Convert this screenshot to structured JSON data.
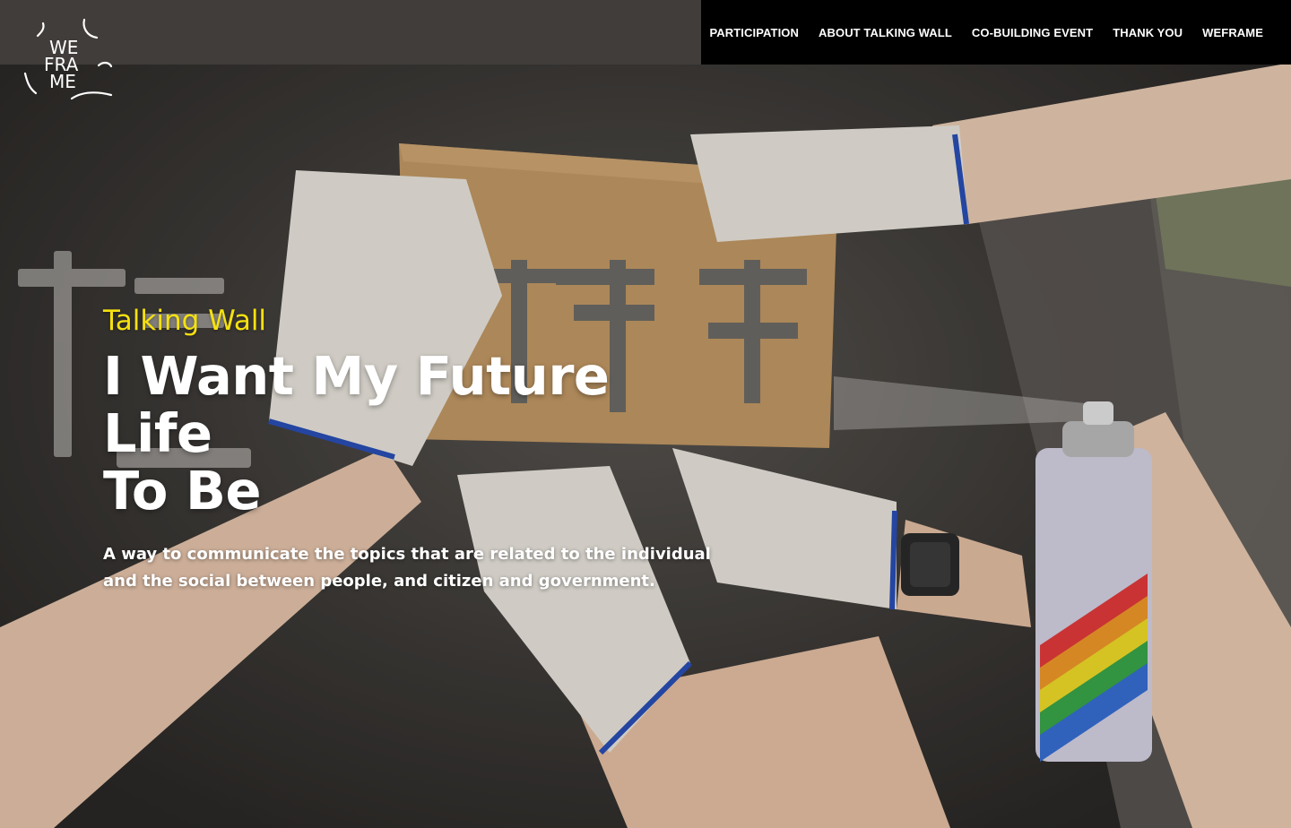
{
  "brand": {
    "logo_alt": "WEFRAME",
    "logo_lines": [
      "WE",
      "FRA",
      "ME"
    ]
  },
  "nav": {
    "items": [
      {
        "label": "PARTICIPATION"
      },
      {
        "label": "ABOUT TALKING WALL"
      },
      {
        "label": "CO-BUILDING EVENT"
      },
      {
        "label": "THANK YOU"
      },
      {
        "label": "WEFRAME"
      }
    ]
  },
  "hero": {
    "eyebrow": "Talking Wall",
    "headline_line1": "I Want My Future Life",
    "headline_line2": "To Be",
    "subtitle": "A way to communicate the topics that are related to the individual and the social between people, and citizen and government."
  },
  "colors": {
    "accent": "#f5e110",
    "nav_bg": "#000000",
    "text": "#ffffff"
  }
}
